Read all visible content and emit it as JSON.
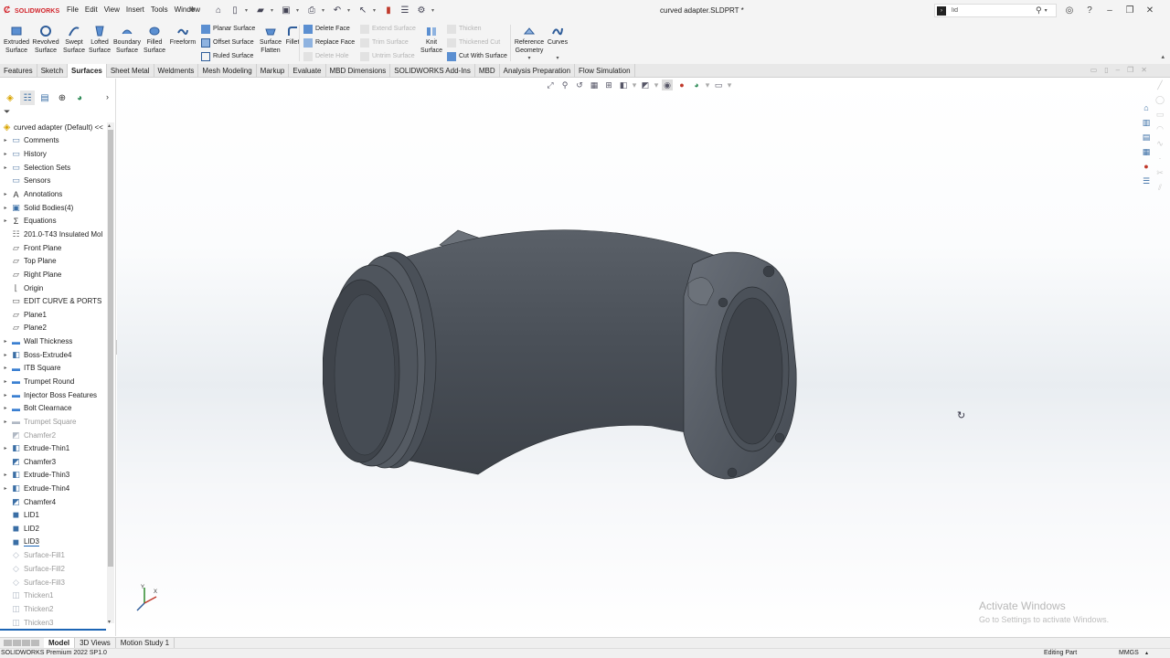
{
  "app": {
    "brand": "SOLIDWORKS",
    "document_title": "curved adapter.SLDPRT *"
  },
  "menu": [
    "File",
    "Edit",
    "View",
    "Insert",
    "Tools",
    "Window"
  ],
  "search": {
    "value": "lid",
    "placeholder": ""
  },
  "command_manager": {
    "big_buttons": [
      {
        "label": "Extruded\nSurface",
        "icon": "extruded-surface-icon",
        "enabled": true
      },
      {
        "label": "Revolved\nSurface",
        "icon": "revolved-surface-icon",
        "enabled": true
      },
      {
        "label": "Swept\nSurface",
        "icon": "swept-surface-icon",
        "enabled": true
      },
      {
        "label": "Lofted\nSurface",
        "icon": "lofted-surface-icon",
        "enabled": true
      },
      {
        "label": "Boundary\nSurface",
        "icon": "boundary-surface-icon",
        "enabled": true
      },
      {
        "label": "Filled\nSurface",
        "icon": "filled-surface-icon",
        "enabled": true
      },
      {
        "label": "Freeform",
        "icon": "freeform-icon",
        "enabled": true
      }
    ],
    "col1": [
      {
        "label": "Planar Surface",
        "enabled": true
      },
      {
        "label": "Offset Surface",
        "enabled": true
      },
      {
        "label": "Ruled Surface",
        "enabled": true
      }
    ],
    "surface_flatten": {
      "label": "Surface\nFlatten",
      "enabled": true
    },
    "fillet": {
      "label": "Fillet",
      "enabled": true
    },
    "col2": [
      {
        "label": "Delete Face",
        "enabled": true
      },
      {
        "label": "Replace Face",
        "enabled": true
      },
      {
        "label": "Delete Hole",
        "enabled": false
      }
    ],
    "col3": [
      {
        "label": "Extend Surface",
        "enabled": false
      },
      {
        "label": "Trim Surface",
        "enabled": false
      },
      {
        "label": "Untrim Surface",
        "enabled": false
      }
    ],
    "knit_surface": {
      "label": "Knit\nSurface",
      "enabled": true
    },
    "col4": [
      {
        "label": "Thicken",
        "enabled": false
      },
      {
        "label": "Thickened Cut",
        "enabled": false
      },
      {
        "label": "Cut With Surface",
        "enabled": true
      }
    ],
    "reference_geometry": {
      "label": "Reference\nGeometry",
      "enabled": true
    },
    "curves": {
      "label": "Curves",
      "enabled": true
    }
  },
  "tabs": [
    {
      "label": "Features",
      "active": false
    },
    {
      "label": "Sketch",
      "active": false
    },
    {
      "label": "Surfaces",
      "active": true
    },
    {
      "label": "Sheet Metal",
      "active": false
    },
    {
      "label": "Weldments",
      "active": false
    },
    {
      "label": "Mesh Modeling",
      "active": false
    },
    {
      "label": "Markup",
      "active": false
    },
    {
      "label": "Evaluate",
      "active": false
    },
    {
      "label": "MBD Dimensions",
      "active": false
    },
    {
      "label": "SOLIDWORKS Add-Ins",
      "active": false
    },
    {
      "label": "MBD",
      "active": false
    },
    {
      "label": "Analysis Preparation",
      "active": false
    },
    {
      "label": "Flow Simulation",
      "active": false
    }
  ],
  "feature_tree": {
    "root": "curved adapter (Default) <<",
    "items": [
      {
        "label": "Comments",
        "icon": "folder-icon",
        "expandable": true,
        "state": "normal"
      },
      {
        "label": "History",
        "icon": "history-icon",
        "expandable": true,
        "state": "normal"
      },
      {
        "label": "Selection Sets",
        "icon": "selection-sets-icon",
        "expandable": true,
        "state": "normal"
      },
      {
        "label": "Sensors",
        "icon": "sensors-icon",
        "expandable": false,
        "state": "normal"
      },
      {
        "label": "Annotations",
        "icon": "annotations-icon",
        "expandable": true,
        "state": "normal"
      },
      {
        "label": "Solid Bodies(4)",
        "icon": "solid-bodies-icon",
        "expandable": true,
        "state": "normal"
      },
      {
        "label": "Equations",
        "icon": "equations-icon",
        "expandable": true,
        "state": "normal"
      },
      {
        "label": "201.0-T43 Insulated Mol",
        "icon": "material-icon",
        "expandable": false,
        "state": "normal"
      },
      {
        "label": "Front Plane",
        "icon": "plane-icon",
        "expandable": false,
        "state": "normal"
      },
      {
        "label": "Top Plane",
        "icon": "plane-icon",
        "expandable": false,
        "state": "normal"
      },
      {
        "label": "Right Plane",
        "icon": "plane-icon",
        "expandable": false,
        "state": "normal"
      },
      {
        "label": "Origin",
        "icon": "origin-icon",
        "expandable": false,
        "state": "normal"
      },
      {
        "label": "EDIT CURVE & PORTS",
        "icon": "sketch-icon",
        "expandable": false,
        "state": "normal"
      },
      {
        "label": "Plane1",
        "icon": "plane-icon",
        "expandable": false,
        "state": "normal"
      },
      {
        "label": "Plane2",
        "icon": "plane-icon",
        "expandable": false,
        "state": "normal"
      },
      {
        "label": "Wall Thickness",
        "icon": "feature-folder-icon",
        "expandable": true,
        "state": "normal"
      },
      {
        "label": "Boss-Extrude4",
        "icon": "boss-extrude-icon",
        "expandable": true,
        "state": "normal"
      },
      {
        "label": "ITB Square",
        "icon": "feature-folder-icon",
        "expandable": true,
        "state": "normal"
      },
      {
        "label": "Trumpet Round",
        "icon": "feature-folder-icon",
        "expandable": true,
        "state": "normal"
      },
      {
        "label": "Injector Boss Features",
        "icon": "feature-folder-icon",
        "expandable": true,
        "state": "normal"
      },
      {
        "label": "Bolt Clearnace",
        "icon": "feature-folder-icon",
        "expandable": true,
        "state": "normal"
      },
      {
        "label": "Trumpet Square",
        "icon": "feature-folder-icon",
        "expandable": true,
        "state": "suppressed"
      },
      {
        "label": "Chamfer2",
        "icon": "chamfer-icon",
        "expandable": false,
        "state": "suppressed"
      },
      {
        "label": "Extrude-Thin1",
        "icon": "boss-extrude-icon",
        "expandable": true,
        "state": "normal"
      },
      {
        "label": "Chamfer3",
        "icon": "chamfer-icon",
        "expandable": false,
        "state": "normal"
      },
      {
        "label": "Extrude-Thin3",
        "icon": "boss-extrude-icon",
        "expandable": true,
        "state": "normal"
      },
      {
        "label": "Extrude-Thin4",
        "icon": "boss-extrude-icon",
        "expandable": true,
        "state": "normal"
      },
      {
        "label": "Chamfer4",
        "icon": "chamfer-icon",
        "expandable": false,
        "state": "normal"
      },
      {
        "label": "LID1",
        "icon": "feature-icon",
        "expandable": false,
        "state": "normal"
      },
      {
        "label": "LID2",
        "icon": "feature-icon",
        "expandable": false,
        "state": "normal"
      },
      {
        "label": "LID3",
        "icon": "feature-icon",
        "expandable": false,
        "state": "selected"
      },
      {
        "label": "Surface-Fill1",
        "icon": "surface-fill-icon",
        "expandable": false,
        "state": "suppressed"
      },
      {
        "label": "Surface-Fill2",
        "icon": "surface-fill-icon",
        "expandable": false,
        "state": "suppressed"
      },
      {
        "label": "Surface-Fill3",
        "icon": "surface-fill-icon",
        "expandable": false,
        "state": "suppressed"
      },
      {
        "label": "Thicken1",
        "icon": "thicken-icon",
        "expandable": false,
        "state": "suppressed"
      },
      {
        "label": "Thicken2",
        "icon": "thicken-icon",
        "expandable": false,
        "state": "suppressed"
      },
      {
        "label": "Thicken3",
        "icon": "thicken-icon",
        "expandable": false,
        "state": "suppressed"
      }
    ]
  },
  "watermark": {
    "line1": "Activate Windows",
    "line2": "Go to Settings to activate Windows."
  },
  "bottom_tabs": [
    {
      "label": "Model",
      "active": true
    },
    {
      "label": "3D Views",
      "active": false
    },
    {
      "label": "Motion Study 1",
      "active": false
    }
  ],
  "status": {
    "left": "SOLIDWORKS Premium 2022 SP1.0",
    "mode": "Editing Part",
    "units": "MMGS"
  },
  "triad": {
    "x": "X",
    "y": "Y"
  },
  "colors": {
    "model_body": "#4d535b",
    "accent": "#1c65b5",
    "brand_red": "#d2232a"
  }
}
